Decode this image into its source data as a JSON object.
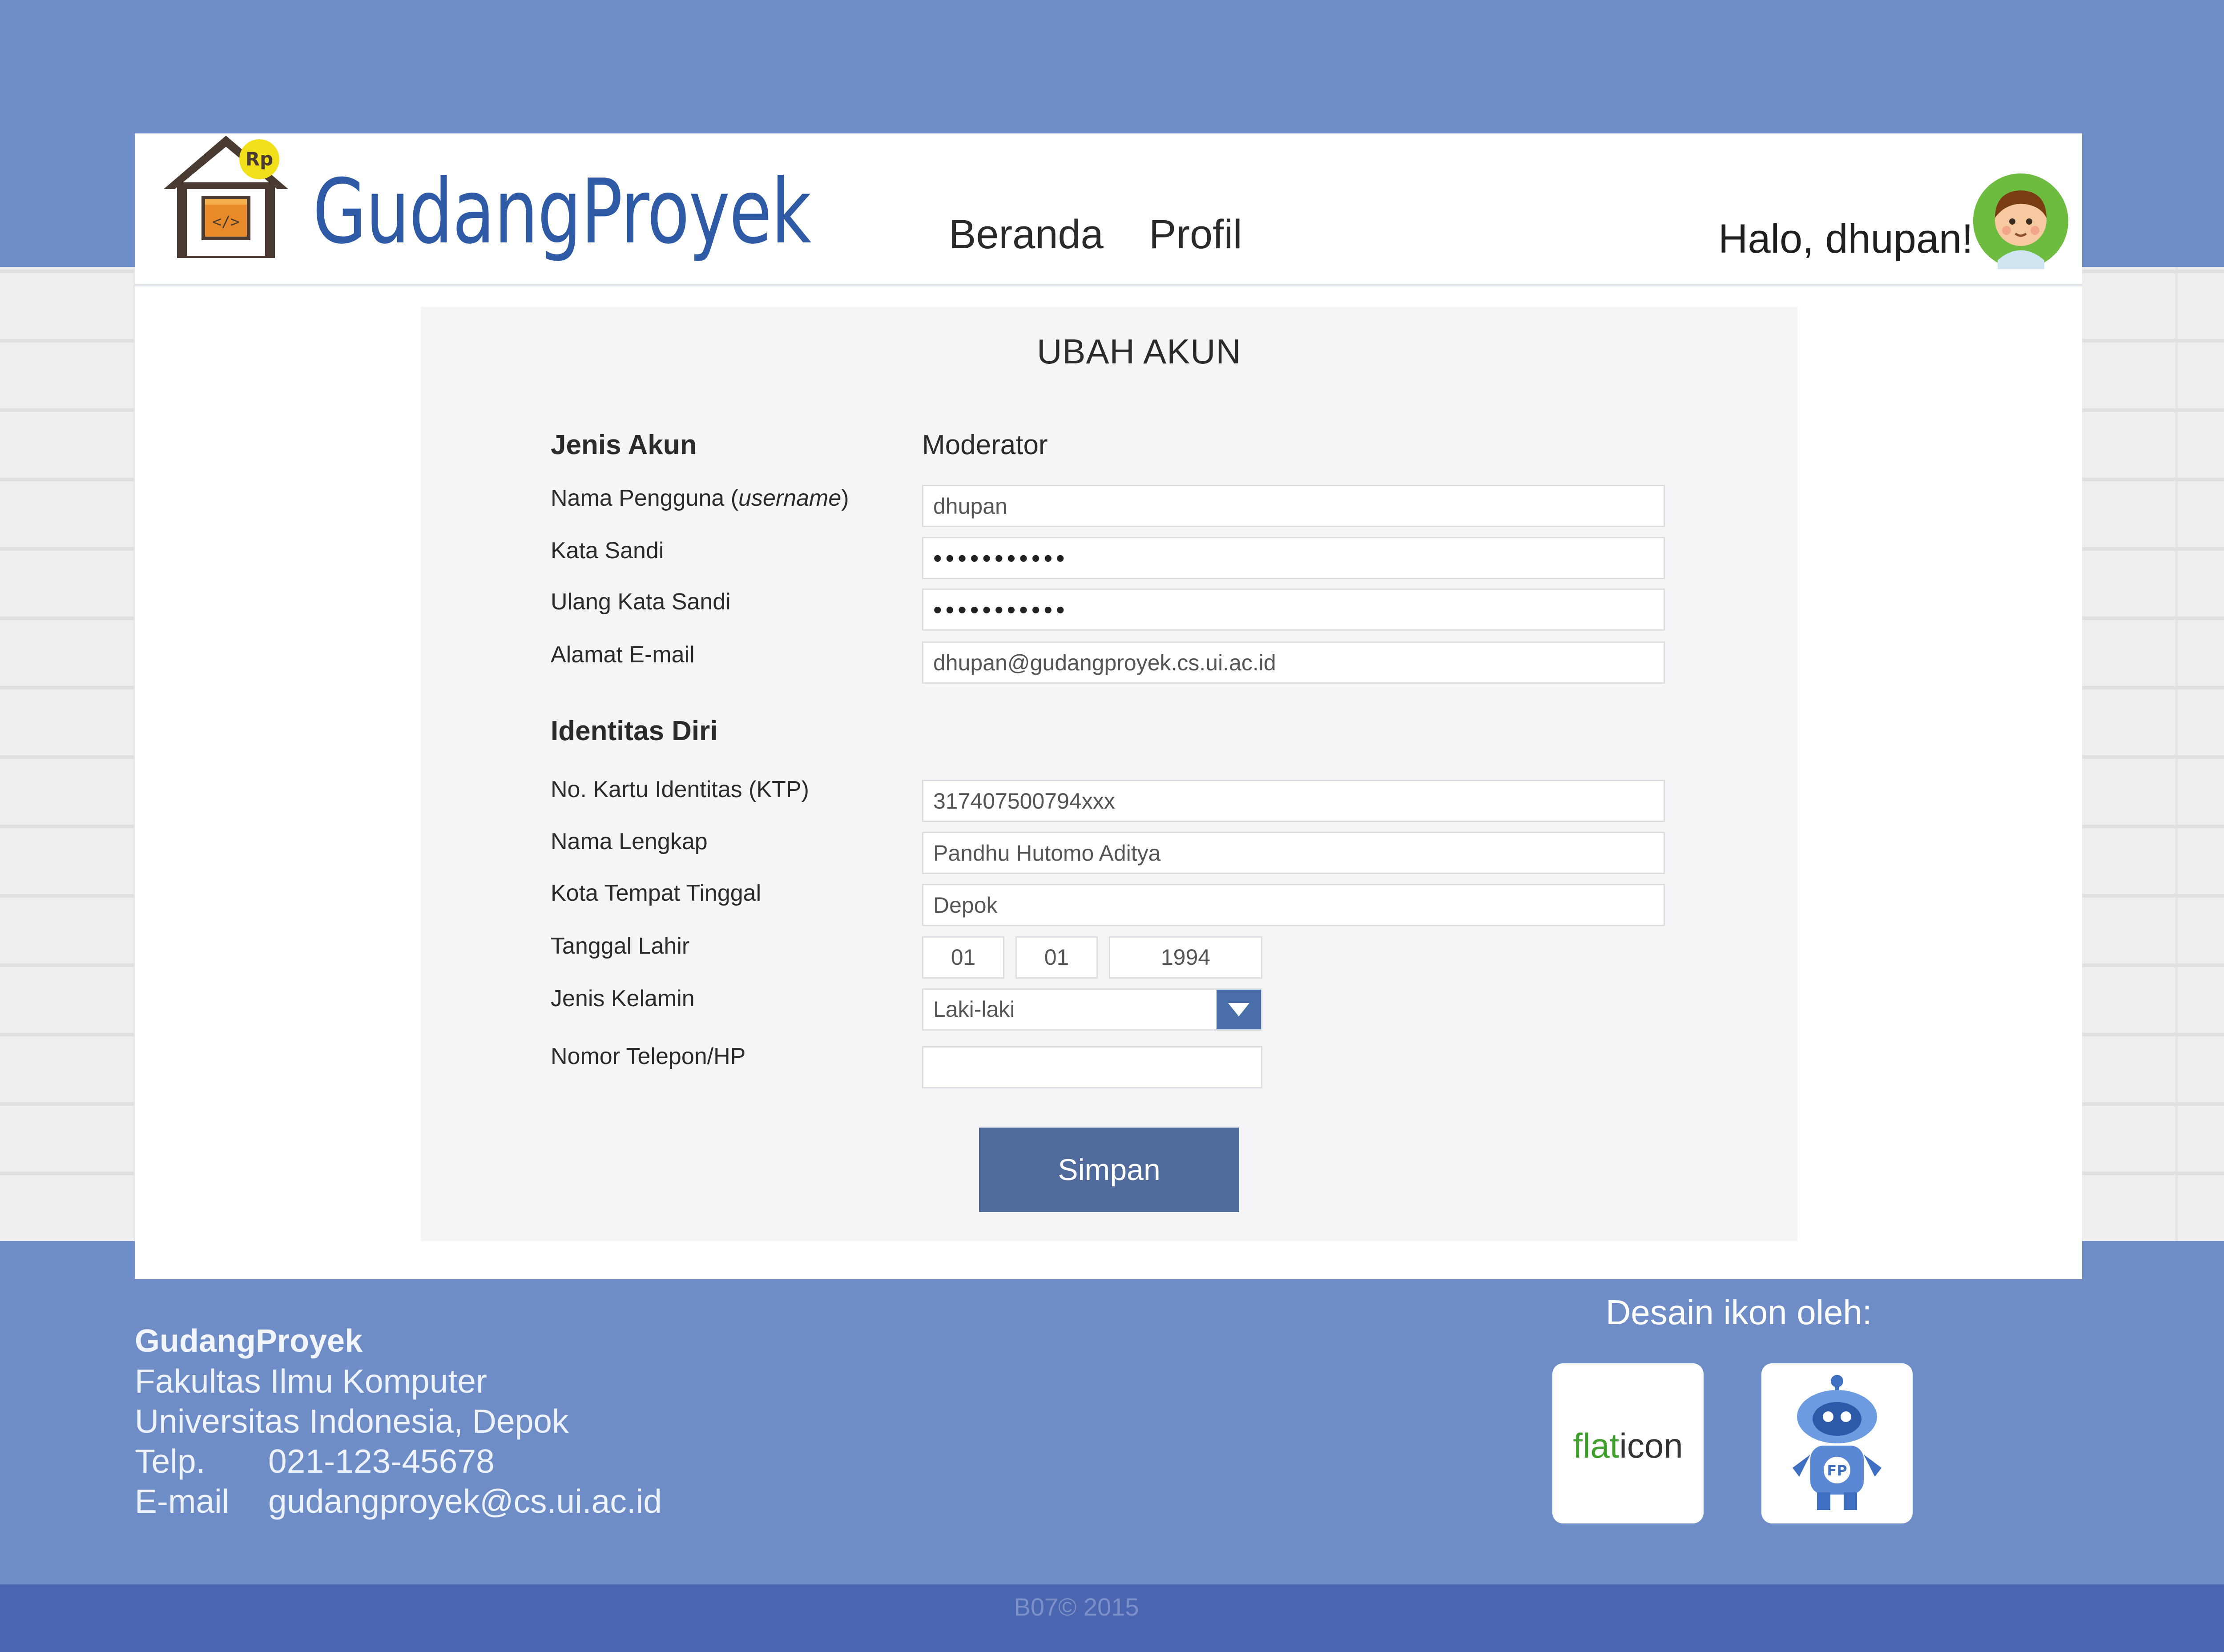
{
  "brand": {
    "name": "GudangProyek",
    "logo_badge": "Rp",
    "logo_code": "</>"
  },
  "nav": {
    "items": [
      {
        "label": "Beranda"
      },
      {
        "label": "Profil"
      }
    ]
  },
  "user": {
    "greeting": "Halo, dhupan!"
  },
  "form": {
    "title": "UBAH AKUN",
    "account": {
      "heading": "Jenis Akun",
      "value": "Moderator",
      "username": {
        "label_main": "Nama Pengguna (",
        "label_italic": "username",
        "label_end": ")",
        "value": "dhupan"
      },
      "password": {
        "label": "Kata Sandi",
        "value": "•••••••••••"
      },
      "password_repeat": {
        "label": "Ulang Kata Sandi",
        "value": "•••••••••••"
      },
      "email": {
        "label": "Alamat E-mail",
        "value": "dhupan@gudangproyek.cs.ui.ac.id"
      }
    },
    "identity": {
      "heading": "Identitas Diri",
      "ktp": {
        "label": "No. Kartu Identitas (KTP)",
        "value": "317407500794xxx"
      },
      "full_name": {
        "label": "Nama Lengkap",
        "value": "Pandhu Hutomo Aditya"
      },
      "city": {
        "label": "Kota Tempat Tinggal",
        "value": "Depok"
      },
      "birth_date": {
        "label": "Tanggal  Lahir",
        "day": "01",
        "month": "01",
        "year": "1994"
      },
      "gender": {
        "label": "Jenis Kelamin",
        "selected": "Laki-laki"
      },
      "phone": {
        "label": "Nomor Telepon/HP",
        "value": ""
      }
    },
    "save_label": "Simpan"
  },
  "footer": {
    "org": "GudangProyek",
    "faculty": "Fakultas Ilmu Komputer",
    "university": "Universitas Indonesia, Depok",
    "phone_label": "Telp.",
    "phone": "021-123-45678",
    "email_label": "E-mail",
    "email": "gudangproyek@cs.ui.ac.id",
    "icons_credit": "Desain ikon oleh:",
    "flaticon_flat": "flat",
    "flaticon_icon": "icon",
    "freepik_badge": "FP",
    "copyright": "B07© 2015"
  },
  "colors": {
    "background": "#6e8cc6",
    "brand": "#2f5aa6",
    "button": "#4f6a9b",
    "bottom_bar": "#4b66b0"
  }
}
